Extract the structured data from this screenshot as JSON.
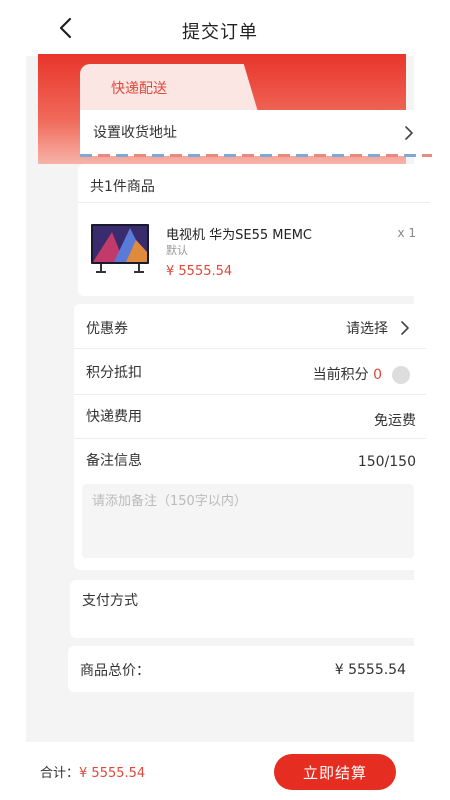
{
  "header": {
    "title": "提交订单"
  },
  "delivery": {
    "tab_label": "快递配送",
    "address_label": "设置收货地址"
  },
  "goods": {
    "count_label": "共1件商品",
    "item": {
      "name": "电视机 华为SE55 MEMC",
      "spec": "默认",
      "price": "¥ 5555.54",
      "quantity": "x 1"
    }
  },
  "options": {
    "coupon": {
      "label": "优惠券",
      "value": "请选择"
    },
    "points": {
      "label": "积分抵扣",
      "current_label": "当前积分",
      "current_value": "0"
    },
    "shipping": {
      "label": "快递费用",
      "value": "免运费"
    },
    "remark": {
      "label": "备注信息",
      "count": "150",
      "max": "/150",
      "placeholder": "请添加备注（150字以内）"
    }
  },
  "payment": {
    "label": "支付方式"
  },
  "summary": {
    "label": "商品总价：",
    "value": "¥ 5555.54"
  },
  "footer": {
    "total_label": "合计：",
    "total_amount": "¥ 5555.54",
    "submit_label": "立即结算"
  },
  "colors": {
    "accent": "#e52d22",
    "price": "#e0483c",
    "background": "#f4f4f4"
  }
}
